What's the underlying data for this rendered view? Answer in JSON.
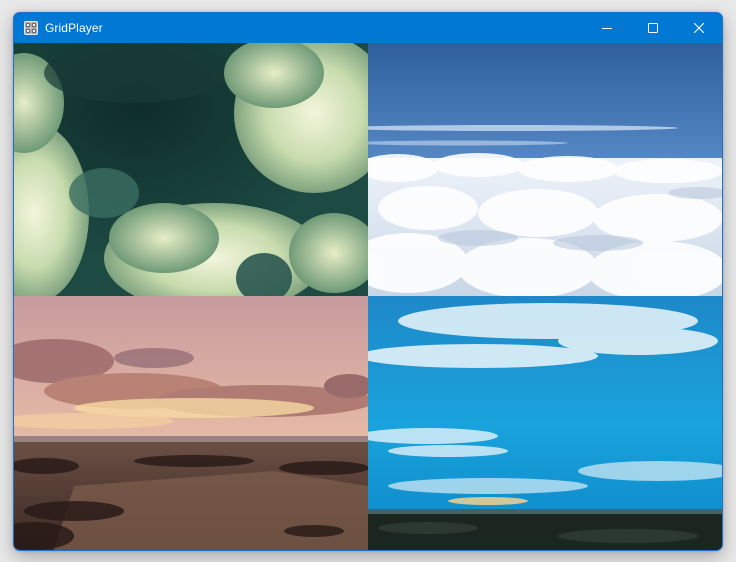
{
  "window": {
    "title": "GridPlayer",
    "app_icon": "grid-icon",
    "controls": [
      "minimize-icon",
      "maximize-icon",
      "close-icon"
    ]
  },
  "colors": {
    "titlebar": "#0078d4",
    "title_text": "#ffffff",
    "border": "#1f6fd1"
  },
  "grid": {
    "rows": 2,
    "columns": 2,
    "cells": [
      {
        "content": "storm-clouds-video"
      },
      {
        "content": "cloud-sea-video"
      },
      {
        "content": "sunset-fields-video"
      },
      {
        "content": "blue-sky-clouds-video"
      }
    ]
  }
}
